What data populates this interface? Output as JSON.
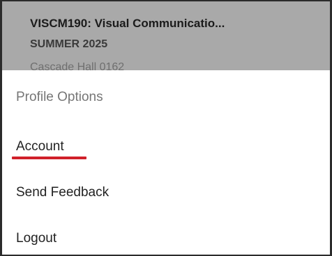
{
  "course": {
    "title": "VISCM190: Visual Communicatio...",
    "term": "SUMMER 2025",
    "location": "Cascade Hall 0162"
  },
  "menu": {
    "heading": "Profile Options",
    "items": [
      {
        "label": "Account"
      },
      {
        "label": "Send Feedback"
      },
      {
        "label": "Logout"
      }
    ]
  },
  "colors": {
    "highlight_underline": "#d0202a",
    "header_overlay": "#a9a9a9"
  }
}
